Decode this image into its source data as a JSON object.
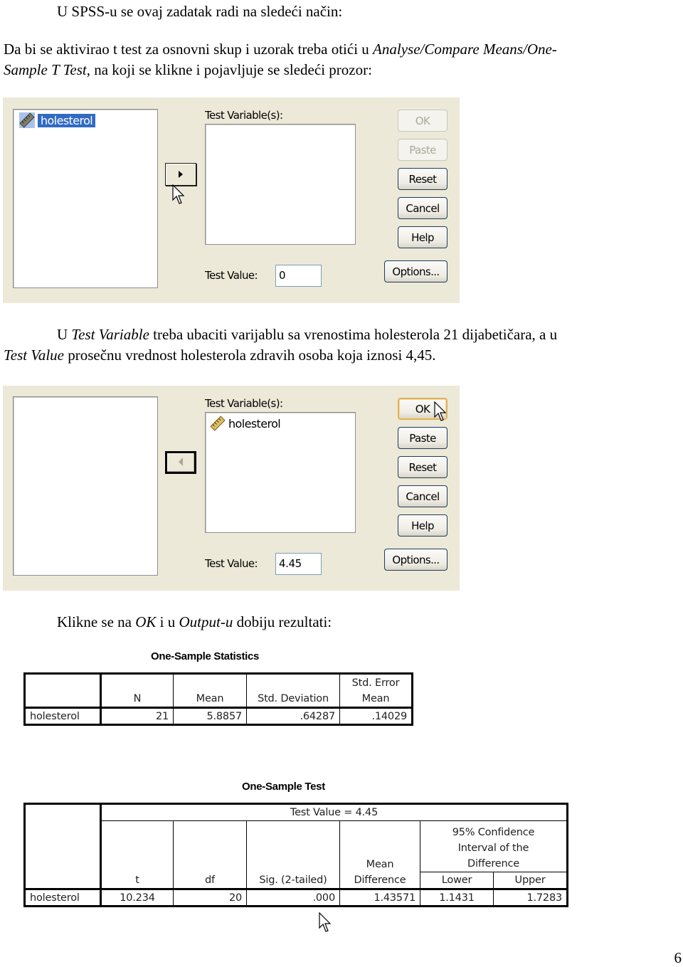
{
  "intro": {
    "heading": "U SPSS-u se ovaj zadatak radi na sledeći način:",
    "line1_text": "Da bi se aktivirao t test za osnovni skup i uzorak treba otići u ",
    "line1_italic": "Analyse/Compare Means/One-",
    "line2_italic": "Sample T Test,",
    "line2_text": " na koji se klikne i pojavljuje se sledeći prozor:"
  },
  "dialog1": {
    "source_variables": [
      {
        "name": "holesterol",
        "icon": "scale-variable-icon",
        "selected": true
      }
    ],
    "move_button_icon": "arrow-right-icon",
    "test_variables_label": "Test Variable(s):",
    "test_variables": [],
    "test_value_label": "Test Value:",
    "test_value": "0",
    "buttons": {
      "ok": "OK",
      "paste": "Paste",
      "reset": "Reset",
      "cancel": "Cancel",
      "help": "Help",
      "options": "Options..."
    },
    "ok_enabled": false,
    "paste_enabled": false
  },
  "middle": {
    "p1_a": "U ",
    "p1_b_italic": "Test Variable",
    "p1_c": " treba ubaciti varijablu sa vrenostima holesterola 21 dijabetičara, a u",
    "p2_a_italic": "Test Value",
    "p2_b": " prosečnu vrednost holesterola zdravih osoba koja iznosi 4,45."
  },
  "dialog2": {
    "source_variables": [],
    "move_button_icon": "arrow-left-icon",
    "test_variables_label": "Test Variable(s):",
    "test_variables": [
      {
        "name": "holesterol",
        "icon": "scale-variable-icon",
        "selected": false
      }
    ],
    "test_value_label": "Test Value:",
    "test_value": "4.45",
    "buttons": {
      "ok": "OK",
      "paste": "Paste",
      "reset": "Reset",
      "cancel": "Cancel",
      "help": "Help",
      "options": "Options..."
    },
    "ok_enabled": true,
    "paste_enabled": true
  },
  "output_intro": {
    "a": "Klikne se na ",
    "b_italic": "OK",
    "c": " i u ",
    "d_italic": "Output-u",
    "e": " dobiju rezultati:"
  },
  "stats_table": {
    "title": "One-Sample Statistics",
    "headers": [
      "",
      "N",
      "Mean",
      "Std. Deviation",
      "Std. Error Mean"
    ],
    "header_se_line1": "Std. Error",
    "header_se_line2": "Mean",
    "rows": [
      {
        "label": "holesterol",
        "n": "21",
        "mean": "5.8857",
        "std_dev": ".64287",
        "std_err": ".14029"
      }
    ]
  },
  "test_table": {
    "title": "One-Sample Test",
    "test_value_header": "Test Value = 4.45",
    "ci_header_l1": "95% Confidence",
    "ci_header_l2": "Interval of the",
    "ci_header_l3": "Difference",
    "headers": {
      "t": "t",
      "df": "df",
      "sig": "Sig. (2-tailed)",
      "mean_diff_l1": "Mean",
      "mean_diff_l2": "Difference",
      "lower": "Lower",
      "upper": "Upper"
    },
    "rows": [
      {
        "label": "holesterol",
        "t": "10.234",
        "df": "20",
        "sig": ".000",
        "mean_diff": "1.43571",
        "lower": "1.1431",
        "upper": "1.7283"
      }
    ]
  },
  "page_number": "6"
}
